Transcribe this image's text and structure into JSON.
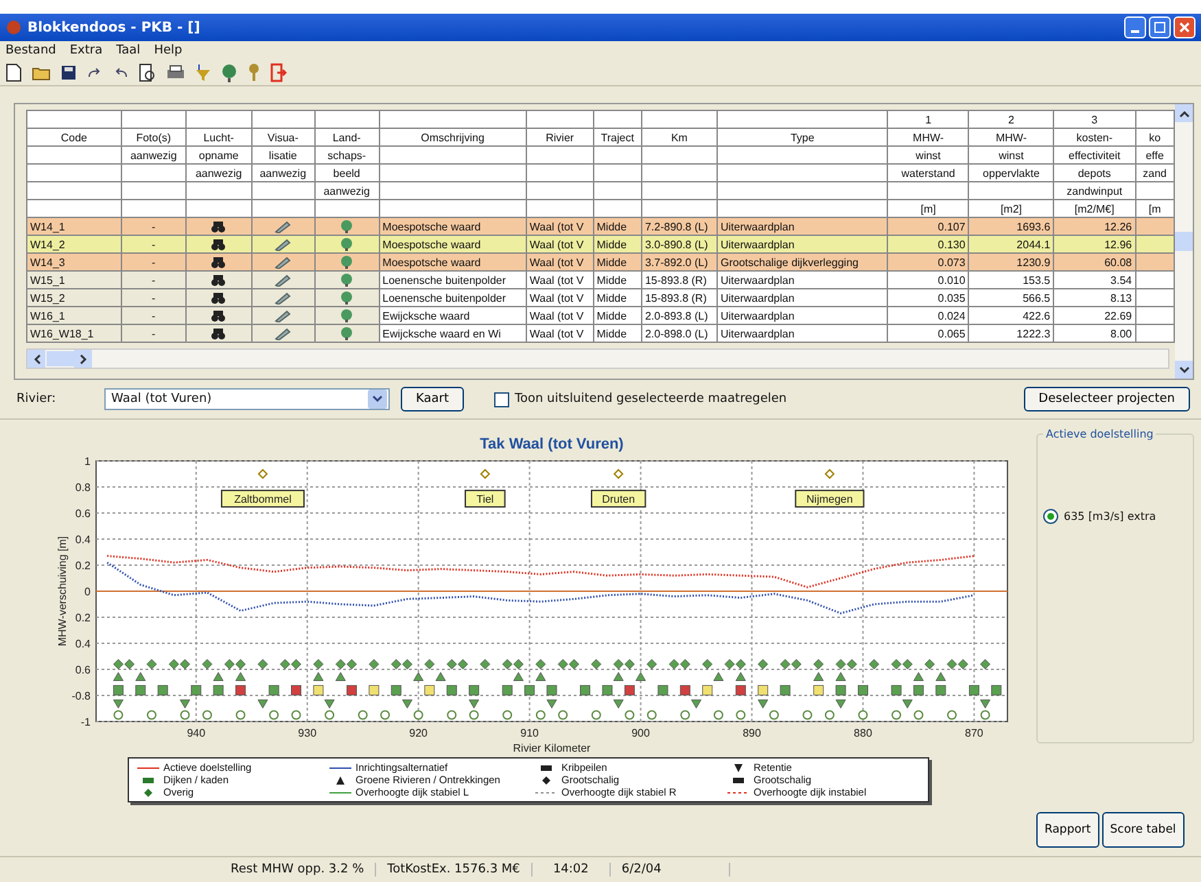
{
  "window": {
    "title": "Blokkendoos - PKB - []"
  },
  "menu": [
    "Bestand",
    "Extra",
    "Taal",
    "Help"
  ],
  "table": {
    "columns": [
      {
        "heading": [
          "Code"
        ]
      },
      {
        "heading": [
          "Foto(s)",
          "aanwezig"
        ]
      },
      {
        "heading": [
          "Lucht-",
          "opname",
          "aanwezig"
        ]
      },
      {
        "heading": [
          "Visua-",
          "lisatie",
          "aanwezig"
        ]
      },
      {
        "heading": [
          "Land-",
          "schaps-",
          "beeld",
          "aanwezig"
        ]
      },
      {
        "heading": [
          "Omschrijving"
        ]
      },
      {
        "heading": [
          "Rivier"
        ]
      },
      {
        "heading": [
          "Traject"
        ]
      },
      {
        "heading": [
          "Km"
        ]
      },
      {
        "heading": [
          "Type"
        ]
      },
      {
        "number": "1",
        "heading": [
          "MHW-",
          "winst",
          "waterstand"
        ],
        "unit": "[m]"
      },
      {
        "number": "2",
        "heading": [
          "MHW-",
          "winst",
          "oppervlakte"
        ],
        "unit": "[m2]"
      },
      {
        "number": "3",
        "heading": [
          "kosten-",
          "effectiviteit",
          "depots",
          "zandwinput"
        ],
        "unit": "[m2/M€]"
      },
      {
        "heading": [
          "ko",
          "effe",
          "zand"
        ],
        "unit": "[m"
      }
    ],
    "rows": [
      {
        "code": "W14_1",
        "photo": "-",
        "description": "Moespotsche waard",
        "river": "Waal (tot V",
        "section": "Midde",
        "km": "7.2-890.8 (L)",
        "type": "Uiterwaardplan",
        "mhw_level": "0.107",
        "mhw_area": "1693.6",
        "cost_eff": "12.26",
        "color": "#f5c9a0"
      },
      {
        "code": "W14_2",
        "photo": "-",
        "description": "Moespotsche waard",
        "river": "Waal (tot V",
        "section": "Midde",
        "km": "3.0-890.8 (L)",
        "type": "Uiterwaardplan",
        "mhw_level": "0.130",
        "mhw_area": "2044.1",
        "cost_eff": "12.96",
        "color": "#eeeea0"
      },
      {
        "code": "W14_3",
        "photo": "-",
        "description": "Moespotsche waard",
        "river": "Waal (tot V",
        "section": "Midde",
        "km": "3.7-892.0 (L)",
        "type": "Grootschalige dijkverlegging",
        "mhw_level": "0.073",
        "mhw_area": "1230.9",
        "cost_eff": "60.08",
        "color": "#f5c9a0"
      },
      {
        "code": "W15_1",
        "photo": "-",
        "description": "Loenensche buitenpolder",
        "river": "Waal (tot V",
        "section": "Midde",
        "km": "15-893.8 (R)",
        "type": "Uiterwaardplan",
        "mhw_level": "0.010",
        "mhw_area": "153.5",
        "cost_eff": "3.54",
        "color": "#ffffff"
      },
      {
        "code": "W15_2",
        "photo": "-",
        "description": "Loenensche buitenpolder",
        "river": "Waal (tot V",
        "section": "Midde",
        "km": "15-893.8 (R)",
        "type": "Uiterwaardplan",
        "mhw_level": "0.035",
        "mhw_area": "566.5",
        "cost_eff": "8.13",
        "color": "#ffffff"
      },
      {
        "code": "W16_1",
        "photo": "-",
        "description": "Ewijcksche waard",
        "river": "Waal (tot V",
        "section": "Midde",
        "km": "2.0-893.8 (L)",
        "type": "Uiterwaardplan",
        "mhw_level": "0.024",
        "mhw_area": "422.6",
        "cost_eff": "22.69",
        "color": "#ffffff"
      },
      {
        "code": "W16_W18_1",
        "photo": "-",
        "description": "Ewijcksche waard en Wi",
        "river": "Waal (tot V",
        "section": "Midde",
        "km": "2.0-898.0 (L)",
        "type": "Uiterwaardplan",
        "mhw_level": "0.065",
        "mhw_area": "1222.3",
        "cost_eff": "8.00",
        "color": "#ffffff"
      }
    ]
  },
  "controls": {
    "river_label": "Rivier:",
    "river_value": "Waal (tot Vuren)",
    "map_button": "Kaart",
    "only_selected": {
      "label": "Toon uitsluitend geselecteerde maatregelen",
      "checked": false
    },
    "deselect_button": "Deselecteer projecten"
  },
  "goal_panel": {
    "title": "Actieve doelstelling",
    "options": [
      {
        "label": "635 [m3/s] extra",
        "selected": true
      }
    ]
  },
  "chart": {
    "chart_data": {
      "type": "line",
      "title": "Tak Waal (tot Vuren)",
      "xlabel": "Rivier Kilometer",
      "ylabel": "MHW-verschuiving [m]",
      "x": [
        948,
        945,
        942,
        939,
        936,
        933,
        930,
        927,
        924,
        921,
        918,
        915,
        912,
        909,
        906,
        903,
        900,
        897,
        894,
        891,
        888,
        885,
        882,
        879,
        876,
        873,
        870
      ],
      "series": [
        {
          "name": "Actieve doelstelling",
          "color": "#e03020",
          "line_style": "dotted",
          "values": [
            0.27,
            0.25,
            0.22,
            0.24,
            0.18,
            0.15,
            0.18,
            0.19,
            0.18,
            0.16,
            0.17,
            0.16,
            0.15,
            0.13,
            0.15,
            0.12,
            0.13,
            0.12,
            0.13,
            0.12,
            0.11,
            0.03,
            0.1,
            0.17,
            0.22,
            0.24,
            0.27
          ]
        },
        {
          "name": "Inrichtingsalternatief",
          "color": "#3050b0",
          "line_style": "dotted",
          "values": [
            0.22,
            0.05,
            -0.03,
            -0.01,
            -0.15,
            -0.09,
            -0.08,
            -0.1,
            -0.11,
            -0.06,
            -0.05,
            -0.04,
            -0.07,
            -0.08,
            -0.06,
            -0.03,
            -0.02,
            -0.04,
            -0.03,
            -0.05,
            -0.02,
            -0.07,
            -0.17,
            -0.1,
            -0.08,
            -0.08,
            -0.03
          ]
        }
      ],
      "xlim": [
        949,
        867
      ],
      "ylim": [
        -1,
        1
      ],
      "xticks": [
        940,
        930,
        920,
        910,
        900,
        890,
        880,
        870
      ],
      "yticks": [
        {
          "value": 1,
          "label": "1"
        },
        {
          "value": 0.8,
          "label": "0.8"
        },
        {
          "value": 0.6,
          "label": "0.6"
        },
        {
          "value": 0.4,
          "label": "0.4"
        },
        {
          "value": 0.2,
          "label": "0.2"
        },
        {
          "value": 0,
          "label": "0"
        },
        {
          "value": -0.2,
          "label": "0.2"
        },
        {
          "value": -0.4,
          "label": "0.4"
        },
        {
          "value": -0.6,
          "label": "0.6"
        },
        {
          "value": -0.8,
          "label": "-0.8"
        },
        {
          "value": -1,
          "label": "-1"
        }
      ],
      "grid": true,
      "ref_lines": [
        {
          "axis": "y",
          "value": 0,
          "color": "#d07030"
        }
      ],
      "annotations": [
        "Zaltbommel",
        "Tiel",
        "Druten",
        "Nijmegen"
      ]
    },
    "legend": [
      {
        "label": "Kribpeilen",
        "kind": "bar",
        "color": "#202020"
      },
      {
        "label": "Retentie",
        "kind": "down",
        "color": "#202020"
      },
      {
        "label": "Dijken / kaden",
        "kind": "bar",
        "color": "#2a7a2a"
      },
      {
        "label": "Groene Rivieren / Ontrekkingen",
        "kind": "up",
        "color": "#202020"
      },
      {
        "label": "Grootschalig",
        "kind": "diamond",
        "color": "#202020"
      },
      {
        "label": "Grootschalig",
        "kind": "bar",
        "color": "#202020"
      },
      {
        "label": "Overig",
        "kind": "diamond",
        "color": "#2a7a2a"
      },
      {
        "label": "Overhoogte dijk stabiel L",
        "kind": "line",
        "color": "#40a040"
      },
      {
        "label": "Overhoogte dijk stabiel R",
        "kind": "dash",
        "color": "#909090"
      },
      {
        "label": "Overhoogte dijk instabiel",
        "kind": "dash",
        "color": "#e03020"
      }
    ]
  },
  "buttons": [
    "Rapport",
    "Score tabel"
  ],
  "status_bar": [
    "Rest MHW opp. 3.2 %",
    "TotKostEx. 1576.3 M€",
    "14:02",
    "6/2/04"
  ]
}
